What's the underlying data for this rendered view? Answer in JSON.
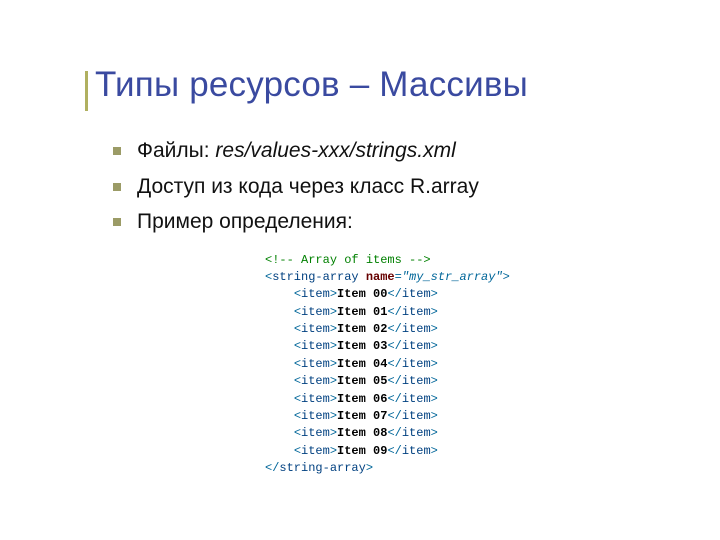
{
  "title": "Типы ресурсов – Массивы",
  "bullets": {
    "b0_prefix": "Файлы: ",
    "b0_italic": "res/values-xxx/strings.xml",
    "b1": "Доступ из кода через класс R.array",
    "b2": "Пример определения:"
  },
  "code": {
    "comment_open": "<!--",
    "comment_text": " Array of items ",
    "comment_close": "-->",
    "lt": "<",
    "gt": ">",
    "slash": "/",
    "tag_string_array": "string-array",
    "attr_name": " name",
    "eq": "=",
    "attr_val": "\"my_str_array\"",
    "tag_item": "item",
    "items": [
      "Item 00",
      "Item 01",
      "Item 02",
      "Item 03",
      "Item 04",
      "Item 05",
      "Item 06",
      "Item 07",
      "Item 08",
      "Item 09"
    ]
  }
}
